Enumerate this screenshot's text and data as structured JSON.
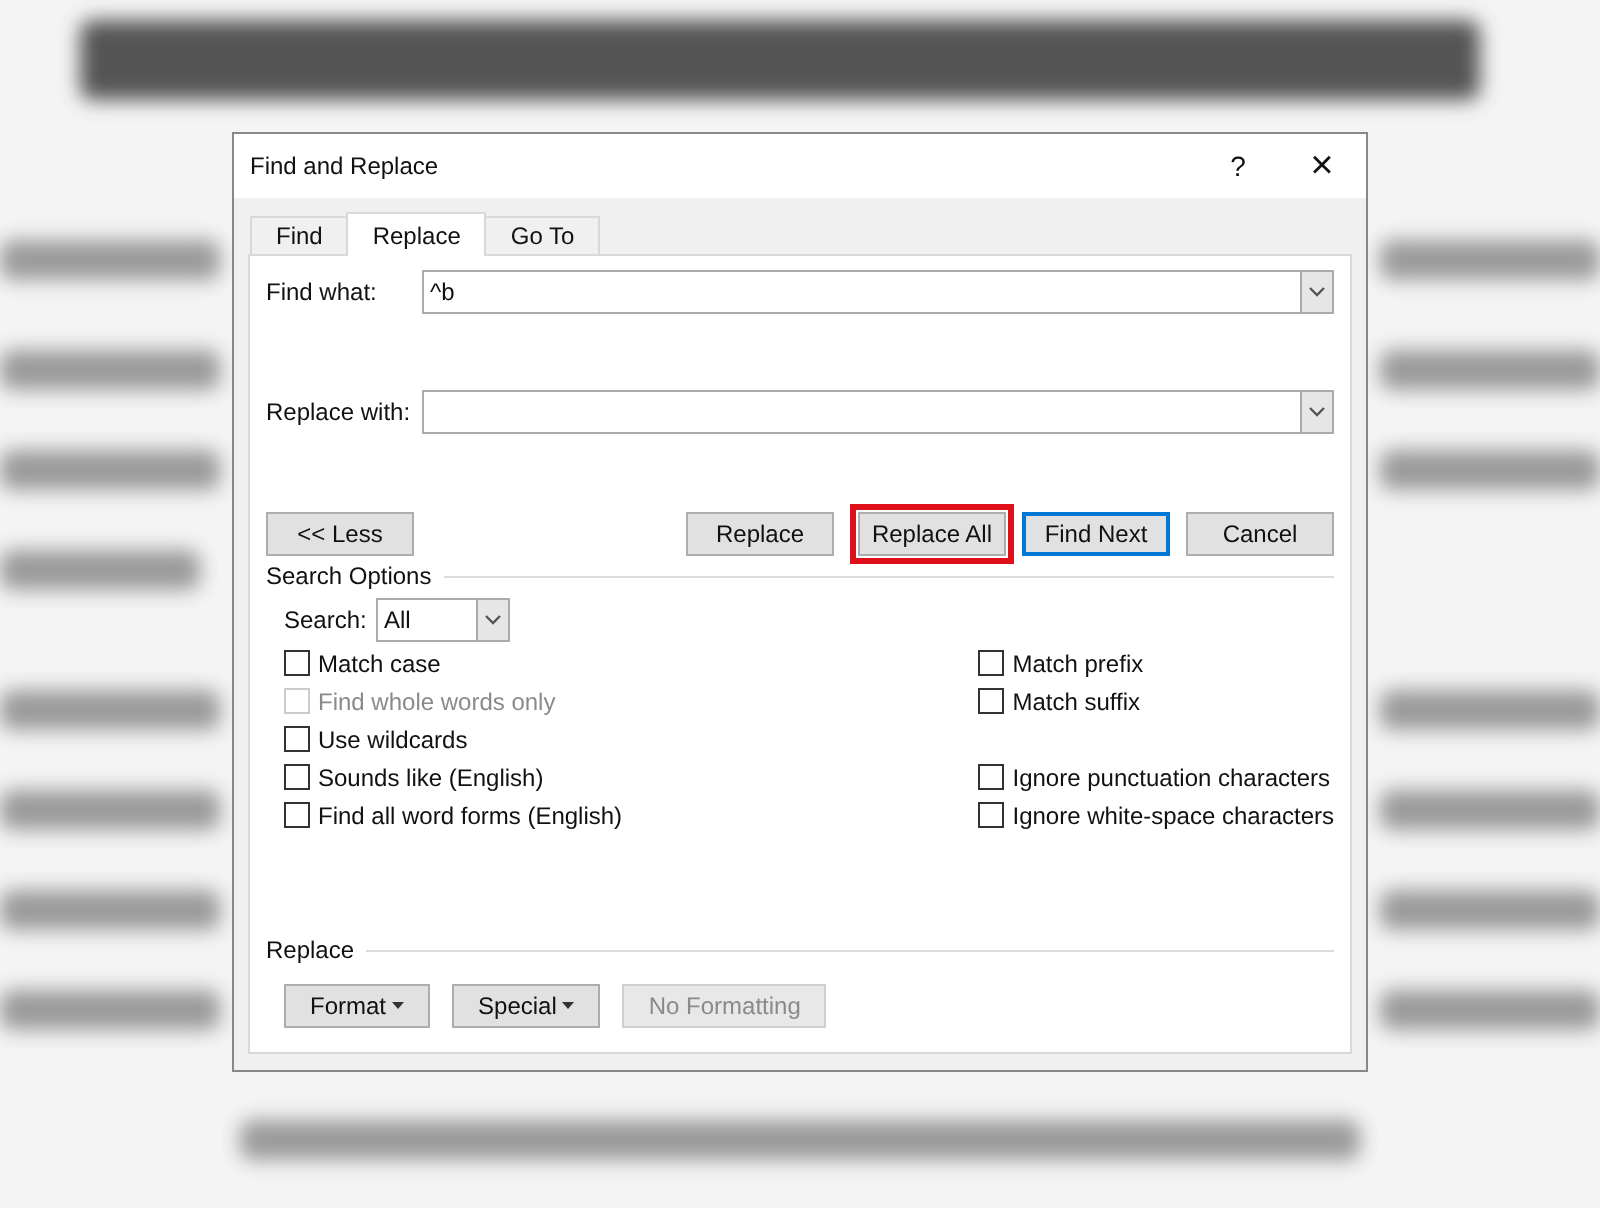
{
  "dialog": {
    "title": "Find and Replace",
    "help": "?",
    "close": "×"
  },
  "tabs": [
    {
      "label": "Find",
      "selected": false
    },
    {
      "label": "Replace",
      "selected": true
    },
    {
      "label": "Go To",
      "selected": false
    }
  ],
  "fields": [
    {
      "label": "Find what:",
      "value": "^b"
    },
    {
      "label": "Replace with:"
    }
  ],
  "less_button": {
    "label": "<< Less"
  },
  "actions": [
    {
      "label": "Replace",
      "default": false,
      "highlighted": false
    },
    {
      "label": "Replace All",
      "default": false,
      "highlighted": true
    },
    {
      "label": "Find Next",
      "default": true,
      "highlighted": false
    },
    {
      "label": "Cancel",
      "default": false,
      "highlighted": false
    }
  ],
  "search_options": {
    "title": "Search Options",
    "search_label": "Search:",
    "search_value": "All"
  },
  "left_options": [
    {
      "label": "Match case",
      "checked": false,
      "disabled": false
    },
    {
      "label": "Find whole words only",
      "checked": false,
      "disabled": true
    },
    {
      "label": "Use wildcards",
      "checked": false,
      "disabled": false
    },
    {
      "label": "Sounds like (English)",
      "checked": false,
      "disabled": false
    },
    {
      "label": "Find all word forms (English)",
      "checked": false,
      "disabled": false
    }
  ],
  "right_groups": [
    [
      {
        "label": "Match prefix",
        "checked": false,
        "disabled": false
      },
      {
        "label": "Match suffix",
        "checked": false,
        "disabled": false
      }
    ],
    [
      {
        "label": "Ignore punctuation characters",
        "checked": false,
        "disabled": false
      },
      {
        "label": "Ignore white-space characters",
        "checked": false,
        "disabled": false
      }
    ]
  ],
  "replace_section": {
    "title": "Replace",
    "buttons": [
      {
        "label": "Format",
        "menu": true,
        "disabled": false
      },
      {
        "label": "Special",
        "menu": true,
        "disabled": false
      },
      {
        "label": "No Formatting",
        "menu": false,
        "disabled": true
      }
    ]
  }
}
